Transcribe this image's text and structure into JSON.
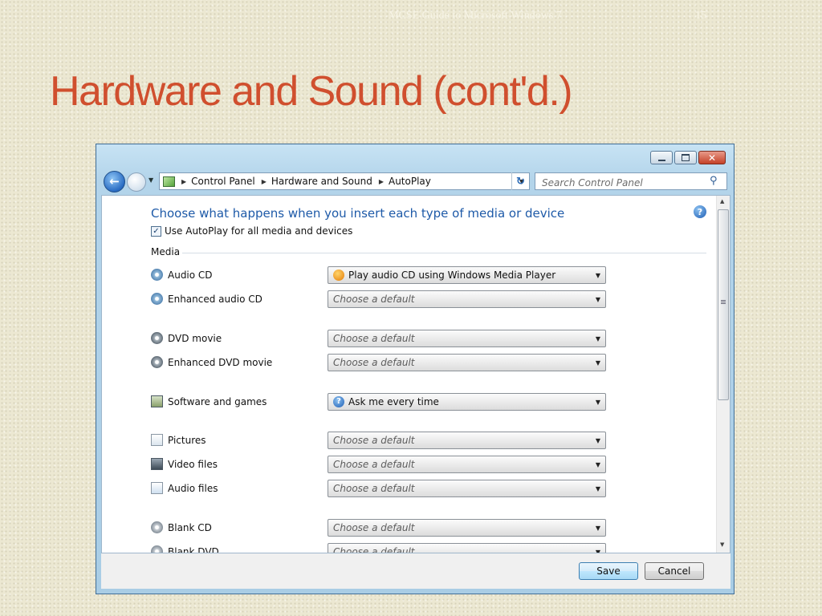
{
  "slide": {
    "header": "MCSE Guide to Microsoft Windows 7",
    "page_number": "15",
    "title": "Hardware and Sound (cont'd.)"
  },
  "window": {
    "address_bar": {
      "crumbs": [
        "Control Panel",
        "Hardware and Sound",
        "AutoPlay"
      ]
    },
    "search": {
      "placeholder": "Search Control Panel"
    },
    "content": {
      "heading": "Choose what happens when you insert each type of media or device",
      "use_autoplay_label": "Use AutoPlay for all media and devices",
      "use_autoplay_checked": true,
      "section_label": "Media",
      "rows": [
        {
          "label": "Audio CD",
          "icon": "audio-cd-icon",
          "value": "Play audio CD using Windows Media Player"
        },
        {
          "label": "Enhanced audio CD",
          "icon": "enhanced-audio-cd-icon",
          "value": "Choose a default"
        },
        {
          "label": "DVD movie",
          "icon": "dvd-movie-icon",
          "value": "Choose a default"
        },
        {
          "label": "Enhanced DVD movie",
          "icon": "enhanced-dvd-movie-icon",
          "value": "Choose a default"
        },
        {
          "label": "Software and games",
          "icon": "software-games-icon",
          "value": "Ask me every time"
        },
        {
          "label": "Pictures",
          "icon": "pictures-icon",
          "value": "Choose a default"
        },
        {
          "label": "Video files",
          "icon": "video-files-icon",
          "value": "Choose a default"
        },
        {
          "label": "Audio files",
          "icon": "audio-files-icon",
          "value": "Choose a default"
        },
        {
          "label": "Blank CD",
          "icon": "blank-cd-icon",
          "value": "Choose a default"
        },
        {
          "label": "Blank DVD",
          "icon": "blank-dvd-icon",
          "value": "Choose a default"
        }
      ]
    },
    "buttons": {
      "save": "Save",
      "cancel": "Cancel"
    }
  },
  "colors": {
    "title": "#d04f2e",
    "heading_link": "#1e5aa8",
    "slide_background": "#ece8d2"
  }
}
